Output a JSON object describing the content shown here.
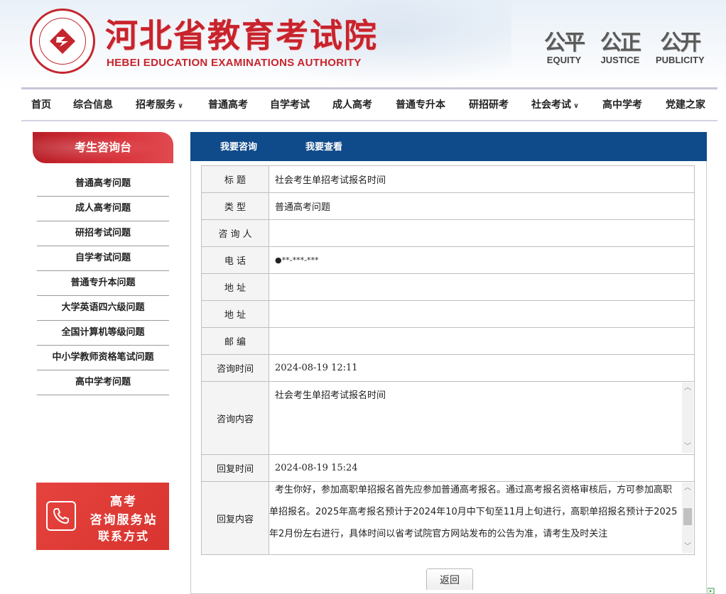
{
  "header": {
    "title": "河北省教育考试院",
    "subtitle": "HEBEI EDUCATION EXAMINATIONS AUTHORITY",
    "mottos": [
      {
        "cn": "公平",
        "en": "EQUITY"
      },
      {
        "cn": "公正",
        "en": "JUSTICE"
      },
      {
        "cn": "公开",
        "en": "PUBLICITY"
      }
    ]
  },
  "nav": {
    "items": [
      {
        "label": "首页"
      },
      {
        "label": "综合信息"
      },
      {
        "label": "招考服务",
        "dropdown": true
      },
      {
        "label": "普通高考"
      },
      {
        "label": "自学考试"
      },
      {
        "label": "成人高考"
      },
      {
        "label": "普通专升本"
      },
      {
        "label": "研招研考"
      },
      {
        "label": "社会考试",
        "dropdown": true
      },
      {
        "label": "高中学考"
      },
      {
        "label": "党建之家"
      }
    ]
  },
  "sidebar": {
    "title": "考生咨询台",
    "items": [
      {
        "label": "普通高考问题"
      },
      {
        "label": "成人高考问题"
      },
      {
        "label": "研招考试问题"
      },
      {
        "label": "自学考试问题"
      },
      {
        "label": "普通专升本问题"
      },
      {
        "label": "大学英语四六级问题"
      },
      {
        "label": "全国计算机等级问题"
      },
      {
        "label": "中小学教师资格笔试问题"
      },
      {
        "label": "高中学考问题"
      }
    ],
    "banner": {
      "line1": "高考",
      "line2": "咨询服务站",
      "line3": "联系方式"
    }
  },
  "tabs": [
    {
      "label": "我要咨询"
    },
    {
      "label": "我要查看"
    }
  ],
  "detail": {
    "title_label": "标 题",
    "title_value": "社会考生单招考试报名时间",
    "type_label": "类 型",
    "type_value": "普通高考问题",
    "asker_label": "咨 询 人",
    "asker_value": "",
    "phone_label": "电 话",
    "phone_value": "●**-***-***",
    "address1_label": "地 址",
    "address1_value": "",
    "address2_label": "地 址",
    "address2_value": "",
    "postcode_label": "邮 编",
    "postcode_value": "",
    "ask_time_label": "咨询时间",
    "ask_time_value": "2024-08-19 12:11",
    "ask_content_label": "咨询内容",
    "ask_content_value": "社会考生单招考试报名时间",
    "reply_time_label": "回复时间",
    "reply_time_value": "2024-08-19 15:24",
    "reply_content_label": "回复内容",
    "reply_content_value": "考生你好，参加高职单招报名首先应参加普通高考报名。通过高考报名资格审核后，方可参加高职单招报名。2025年高考报名预计于2024年10月中下旬至11月上旬进行，高职单招报名预计于2025年2月份左右进行，具体时间以省考试院官方网站发布的公告为准，请考生及时关注"
  },
  "back_button": "返回",
  "colors": {
    "brand_red": "#c8232c",
    "tab_blue": "#0f4a8a"
  }
}
